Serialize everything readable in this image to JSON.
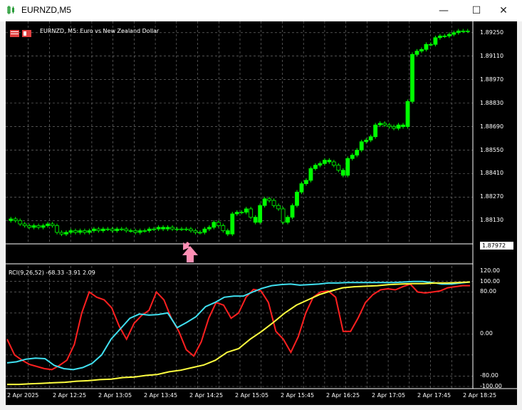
{
  "window": {
    "title": "EURNZD,M5",
    "controls": {
      "minimize": "—",
      "maximize": "☐",
      "close": "✕"
    }
  },
  "chart": {
    "symbol_description": "EURNZD, M5:  Euro vs New Zealand Dollar",
    "current_price": "1.87972",
    "price_axis": [
      "1.89250",
      "1.89110",
      "1.88970",
      "1.88830",
      "1.88690",
      "1.88550",
      "1.88410",
      "1.88270",
      "1.88130"
    ],
    "time_axis": [
      "2 Apr 2025",
      "2 Apr 12:25",
      "2 Apr 13:05",
      "2 Apr 13:45",
      "2 Apr 14:25",
      "2 Apr 15:05",
      "2 Apr 15:45",
      "2 Apr 16:25",
      "2 Apr 17:05",
      "2 Apr 17:45",
      "2 Apr 18:25"
    ],
    "colors": {
      "background": "#000000",
      "bull": "#00ff00",
      "bear": "#000000",
      "grid": "#808080",
      "arrow": "#ff8fb4"
    }
  },
  "indicator": {
    "label": "RCI(9,26,52) -68.33 -3.91 2.09",
    "axis": [
      "120.00",
      "100.00",
      "80.00",
      "0.00",
      "-80.00",
      "-100.00"
    ],
    "colors": {
      "fast": "#ff2020",
      "mid": "#40e0f0",
      "slow": "#ffff40"
    }
  },
  "chart_data": [
    {
      "type": "candlestick",
      "title": "EURNZD, M5:  Euro vs New Zealand Dollar",
      "ylim": [
        1.88,
        1.893
      ],
      "close": [
        1.8814,
        1.8813,
        1.8811,
        1.881,
        1.8809,
        1.881,
        1.8809,
        1.881,
        1.8811,
        1.881,
        1.8806,
        1.8805,
        1.8806,
        1.8807,
        1.8806,
        1.8807,
        1.8806,
        1.8807,
        1.8808,
        1.8807,
        1.8808,
        1.8808,
        1.8807,
        1.8808,
        1.8808,
        1.8807,
        1.8807,
        1.8806,
        1.8807,
        1.8807,
        1.8808,
        1.8808,
        1.8809,
        1.8808,
        1.8809,
        1.8808,
        1.8808,
        1.8808,
        1.8808,
        1.8807,
        1.8806,
        1.8806,
        1.8808,
        1.8809,
        1.8812,
        1.881,
        1.8807,
        1.8805,
        1.8817,
        1.8818,
        1.8818,
        1.882,
        1.8815,
        1.8812,
        1.8822,
        1.8826,
        1.8825,
        1.8822,
        1.882,
        1.8812,
        1.8815,
        1.8822,
        1.883,
        1.8835,
        1.8837,
        1.8844,
        1.8846,
        1.8847,
        1.8849,
        1.8848,
        1.8846,
        1.8843,
        1.884,
        1.885,
        1.8852,
        1.8855,
        1.886,
        1.8861,
        1.8863,
        1.887,
        1.8871,
        1.887,
        1.8869,
        1.8868,
        1.887,
        1.8869,
        1.8884,
        1.8912,
        1.8914,
        1.8915,
        1.8918,
        1.8918,
        1.8922,
        1.8923,
        1.8923,
        1.8924,
        1.8925,
        1.8926,
        1.8926,
        1.8926
      ],
      "bull_indices": [
        26,
        33,
        47,
        48,
        51,
        53,
        55,
        61,
        62,
        63,
        64,
        65,
        66,
        67,
        68,
        69,
        72,
        73,
        74,
        75,
        76,
        77,
        78,
        80,
        84,
        85,
        86,
        87,
        88,
        89,
        91,
        92,
        93,
        94,
        95,
        96
      ]
    },
    {
      "type": "line",
      "title": "RCI(9,26,52) -68.33 -3.91 2.09",
      "ylim": [
        -100,
        120
      ],
      "series": [
        {
          "name": "RCI(9)",
          "values": [
            -10,
            -40,
            -50,
            -58,
            -62,
            -66,
            -68,
            -60,
            -50,
            -20,
            40,
            80,
            70,
            65,
            50,
            15,
            -10,
            20,
            35,
            45,
            80,
            65,
            30,
            5,
            -30,
            -42,
            -15,
            30,
            60,
            55,
            30,
            40,
            70,
            85,
            82,
            60,
            5,
            -10,
            -35,
            -5,
            40,
            70,
            80,
            82,
            70,
            5,
            5,
            30,
            60,
            75,
            84,
            86,
            84,
            90,
            95,
            80,
            78,
            80,
            82,
            88,
            90,
            92,
            92
          ]
        },
        {
          "name": "RCI(26)",
          "values": [
            -55,
            -53,
            -48,
            -46,
            -47,
            -60,
            -66,
            -68,
            -64,
            -56,
            -40,
            -10,
            10,
            30,
            38,
            36,
            37,
            40,
            12,
            22,
            33,
            52,
            60,
            70,
            72,
            72,
            80,
            87,
            92,
            94,
            95,
            93,
            94,
            95,
            97,
            97,
            98,
            98,
            98,
            98,
            98,
            98,
            99,
            100,
            100,
            98,
            95,
            95,
            97,
            99
          ]
        },
        {
          "name": "RCI(52)",
          "values": [
            -96,
            -96,
            -95,
            -94,
            -93,
            -92,
            -90,
            -89,
            -87,
            -86,
            -83,
            -82,
            -79,
            -77,
            -72,
            -69,
            -64,
            -59,
            -50,
            -35,
            -28,
            -10,
            5,
            22,
            40,
            55,
            65,
            75,
            82,
            88,
            90,
            91,
            92,
            94,
            95,
            96,
            96,
            97,
            97,
            98,
            99
          ]
        }
      ]
    }
  ]
}
